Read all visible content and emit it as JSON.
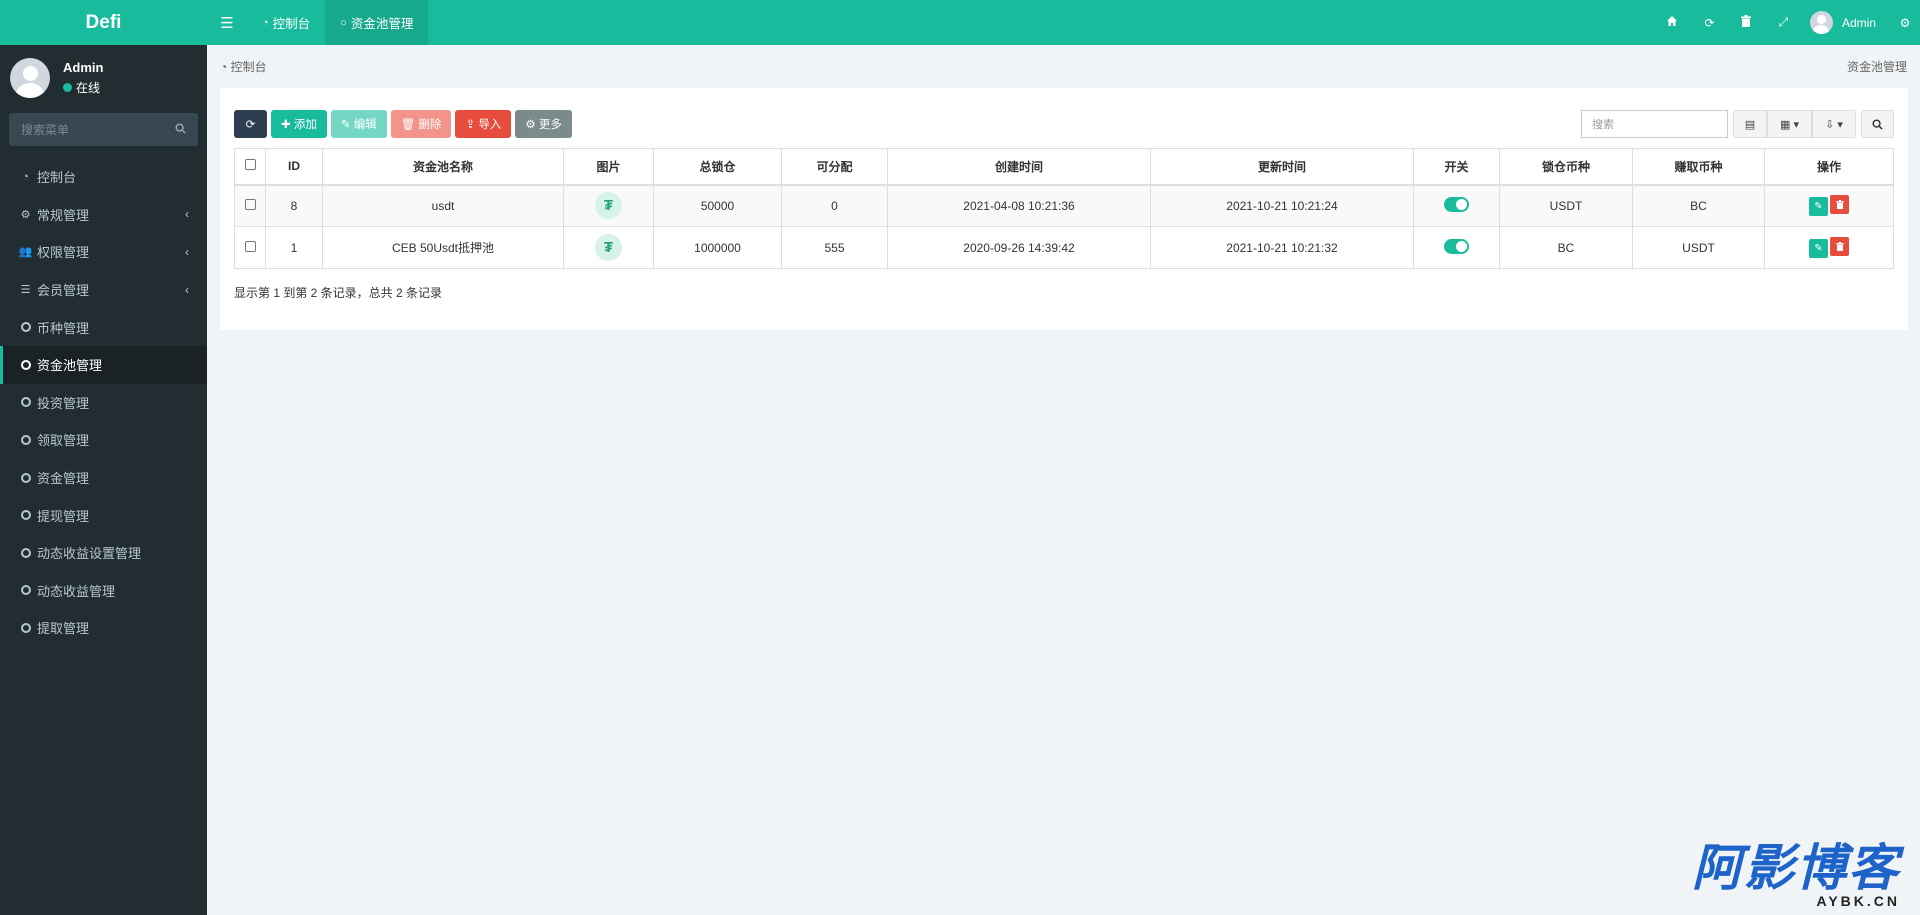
{
  "brand": "Defi",
  "user": {
    "name": "Admin",
    "status": "在线"
  },
  "sidebar": {
    "search_placeholder": "搜索菜单",
    "items": [
      {
        "label": "控制台"
      },
      {
        "label": "常规管理"
      },
      {
        "label": "权限管理"
      },
      {
        "label": "会员管理"
      },
      {
        "label": "币种管理"
      },
      {
        "label": "资金池管理"
      },
      {
        "label": "投资管理"
      },
      {
        "label": "领取管理"
      },
      {
        "label": "资金管理"
      },
      {
        "label": "提现管理"
      },
      {
        "label": "动态收益设置管理"
      },
      {
        "label": "动态收益管理"
      },
      {
        "label": "提取管理"
      }
    ]
  },
  "topnav": {
    "tabs": [
      {
        "label": "控制台"
      },
      {
        "label": "资金池管理"
      }
    ],
    "admin": "Admin"
  },
  "breadcrumb": {
    "home": "控制台",
    "current": "资金池管理"
  },
  "toolbar": {
    "add": "添加",
    "edit": "编辑",
    "delete": "删除",
    "import": "导入",
    "more": "更多",
    "search_placeholder": "搜索"
  },
  "table": {
    "headers": [
      "ID",
      "资金池名称",
      "图片",
      "总锁仓",
      "可分配",
      "创建时间",
      "更新时间",
      "开关",
      "锁仓币种",
      "赚取币种",
      "操作"
    ],
    "rows": [
      {
        "id": "8",
        "name": "usdt",
        "total": "50000",
        "dist": "0",
        "created": "2021-04-08 10:21:36",
        "updated": "2021-10-21 10:21:24",
        "lock": "USDT",
        "earn": "BC"
      },
      {
        "id": "1",
        "name": "CEB 50Usdt抵押池",
        "total": "1000000",
        "dist": "555",
        "created": "2020-09-26 14:39:42",
        "updated": "2021-10-21 10:21:32",
        "lock": "BC",
        "earn": "USDT"
      }
    ],
    "summary": "显示第 1 到第 2 条记录，总共 2 条记录"
  },
  "watermark": {
    "main": "阿影博客",
    "sub": "AYBK.CN"
  },
  "colors": {
    "primary": "#18bc9c",
    "sidebar": "#222d32",
    "danger": "#e74c3c",
    "dark": "#2c3e50"
  }
}
